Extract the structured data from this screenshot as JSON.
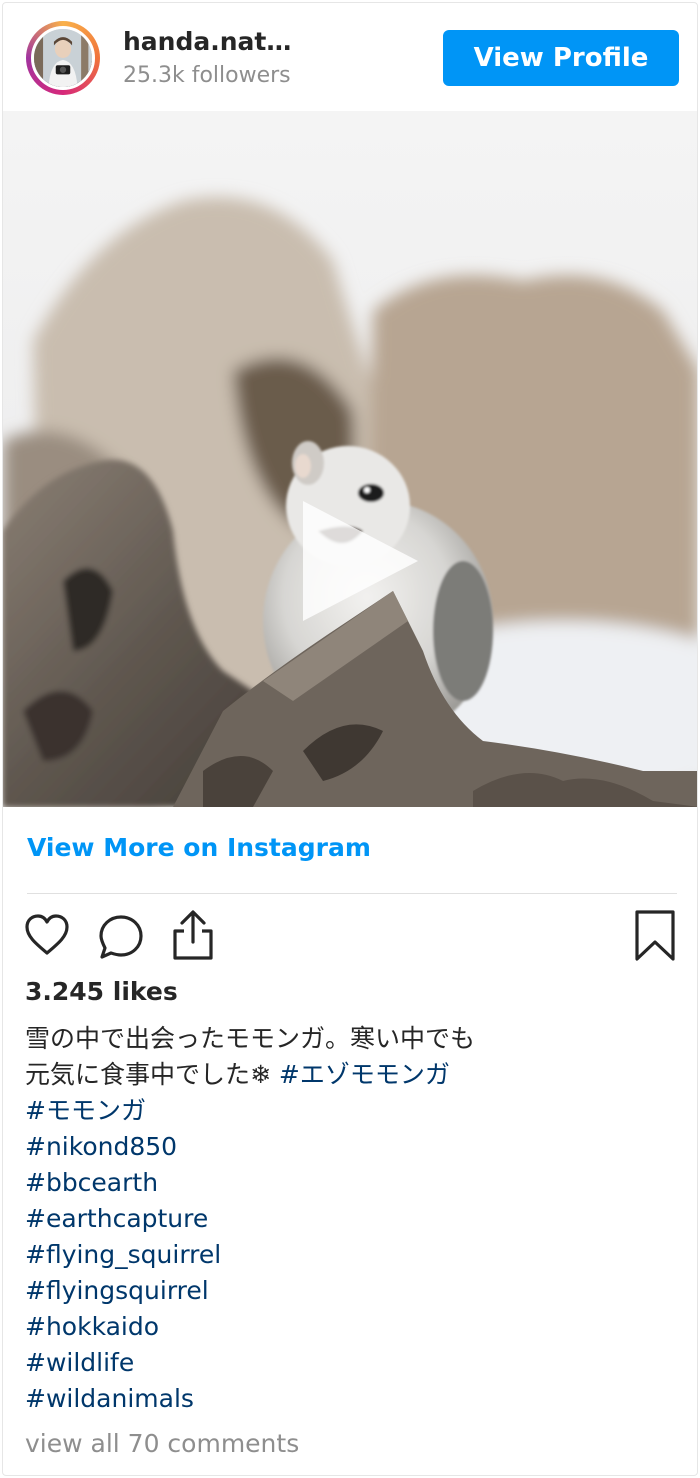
{
  "header": {
    "username": "handa.nat…",
    "followers": "25.3k followers",
    "view_profile_label": "View Profile"
  },
  "media": {
    "type": "video",
    "subject_icon": "play-icon"
  },
  "view_more_label": "View More on Instagram",
  "actions": {
    "icons": [
      "heart-icon",
      "comment-icon",
      "share-icon",
      "bookmark-icon"
    ]
  },
  "likes": "3.245 likes",
  "caption": {
    "line1": "雪の中で出会ったモモンガ。寒い中でも",
    "line2_text": "元気に食事中でした❄ ",
    "line2_tag": "#エゾモモンガ",
    "tags": [
      "#モモンガ",
      "#nikond850",
      "#bbcearth",
      "#earthcapture",
      "#flying_squirrel",
      "#flyingsquirrel",
      "#hokkaido",
      "#wildlife",
      "#wildanimals"
    ]
  },
  "comments_link": "view all 70 comments",
  "colors": {
    "accent": "#0095f6",
    "hashtag": "#00376b",
    "muted": "#8e8e8e",
    "text": "#262626"
  }
}
